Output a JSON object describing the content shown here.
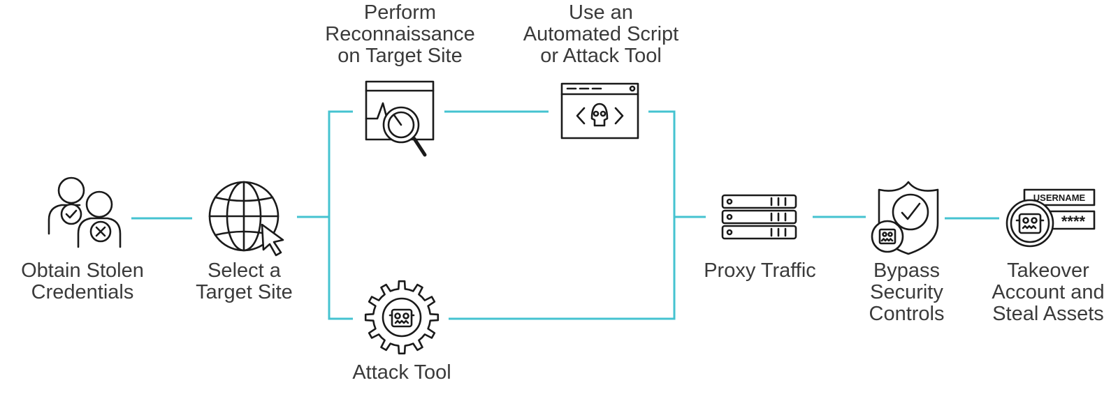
{
  "colors": {
    "connector": "#45c3d0",
    "icon_stroke": "#1a1a1a",
    "label_text": "#3a3a3a",
    "background": "#ffffff"
  },
  "nodes": {
    "obtain": {
      "icon": "users-check-cross-icon",
      "lines": [
        "Obtain Stolen",
        "Credentials"
      ]
    },
    "select": {
      "icon": "globe-cursor-icon",
      "lines": [
        "Select a",
        "Target Site"
      ]
    },
    "recon": {
      "icon": "browser-magnifier-icon",
      "lines": [
        "Perform",
        "Reconnaissance",
        "on Target Site"
      ]
    },
    "script": {
      "icon": "browser-code-skull-icon",
      "lines": [
        "Use an",
        "Automated Script",
        "or Attack Tool"
      ]
    },
    "attack": {
      "icon": "gear-bot-icon",
      "lines": [
        "Attack Tool"
      ]
    },
    "proxy": {
      "icon": "server-stack-icon",
      "lines": [
        "Proxy Traffic"
      ]
    },
    "bypass": {
      "icon": "shield-check-bot-icon",
      "lines": [
        "Bypass",
        "Security",
        "Controls"
      ]
    },
    "takeover": {
      "icon": "login-form-bot-icon",
      "lines": [
        "Takeover",
        "Account and",
        "Steal Assets"
      ],
      "username_label": "USERNAME",
      "password_mask": "****"
    }
  }
}
